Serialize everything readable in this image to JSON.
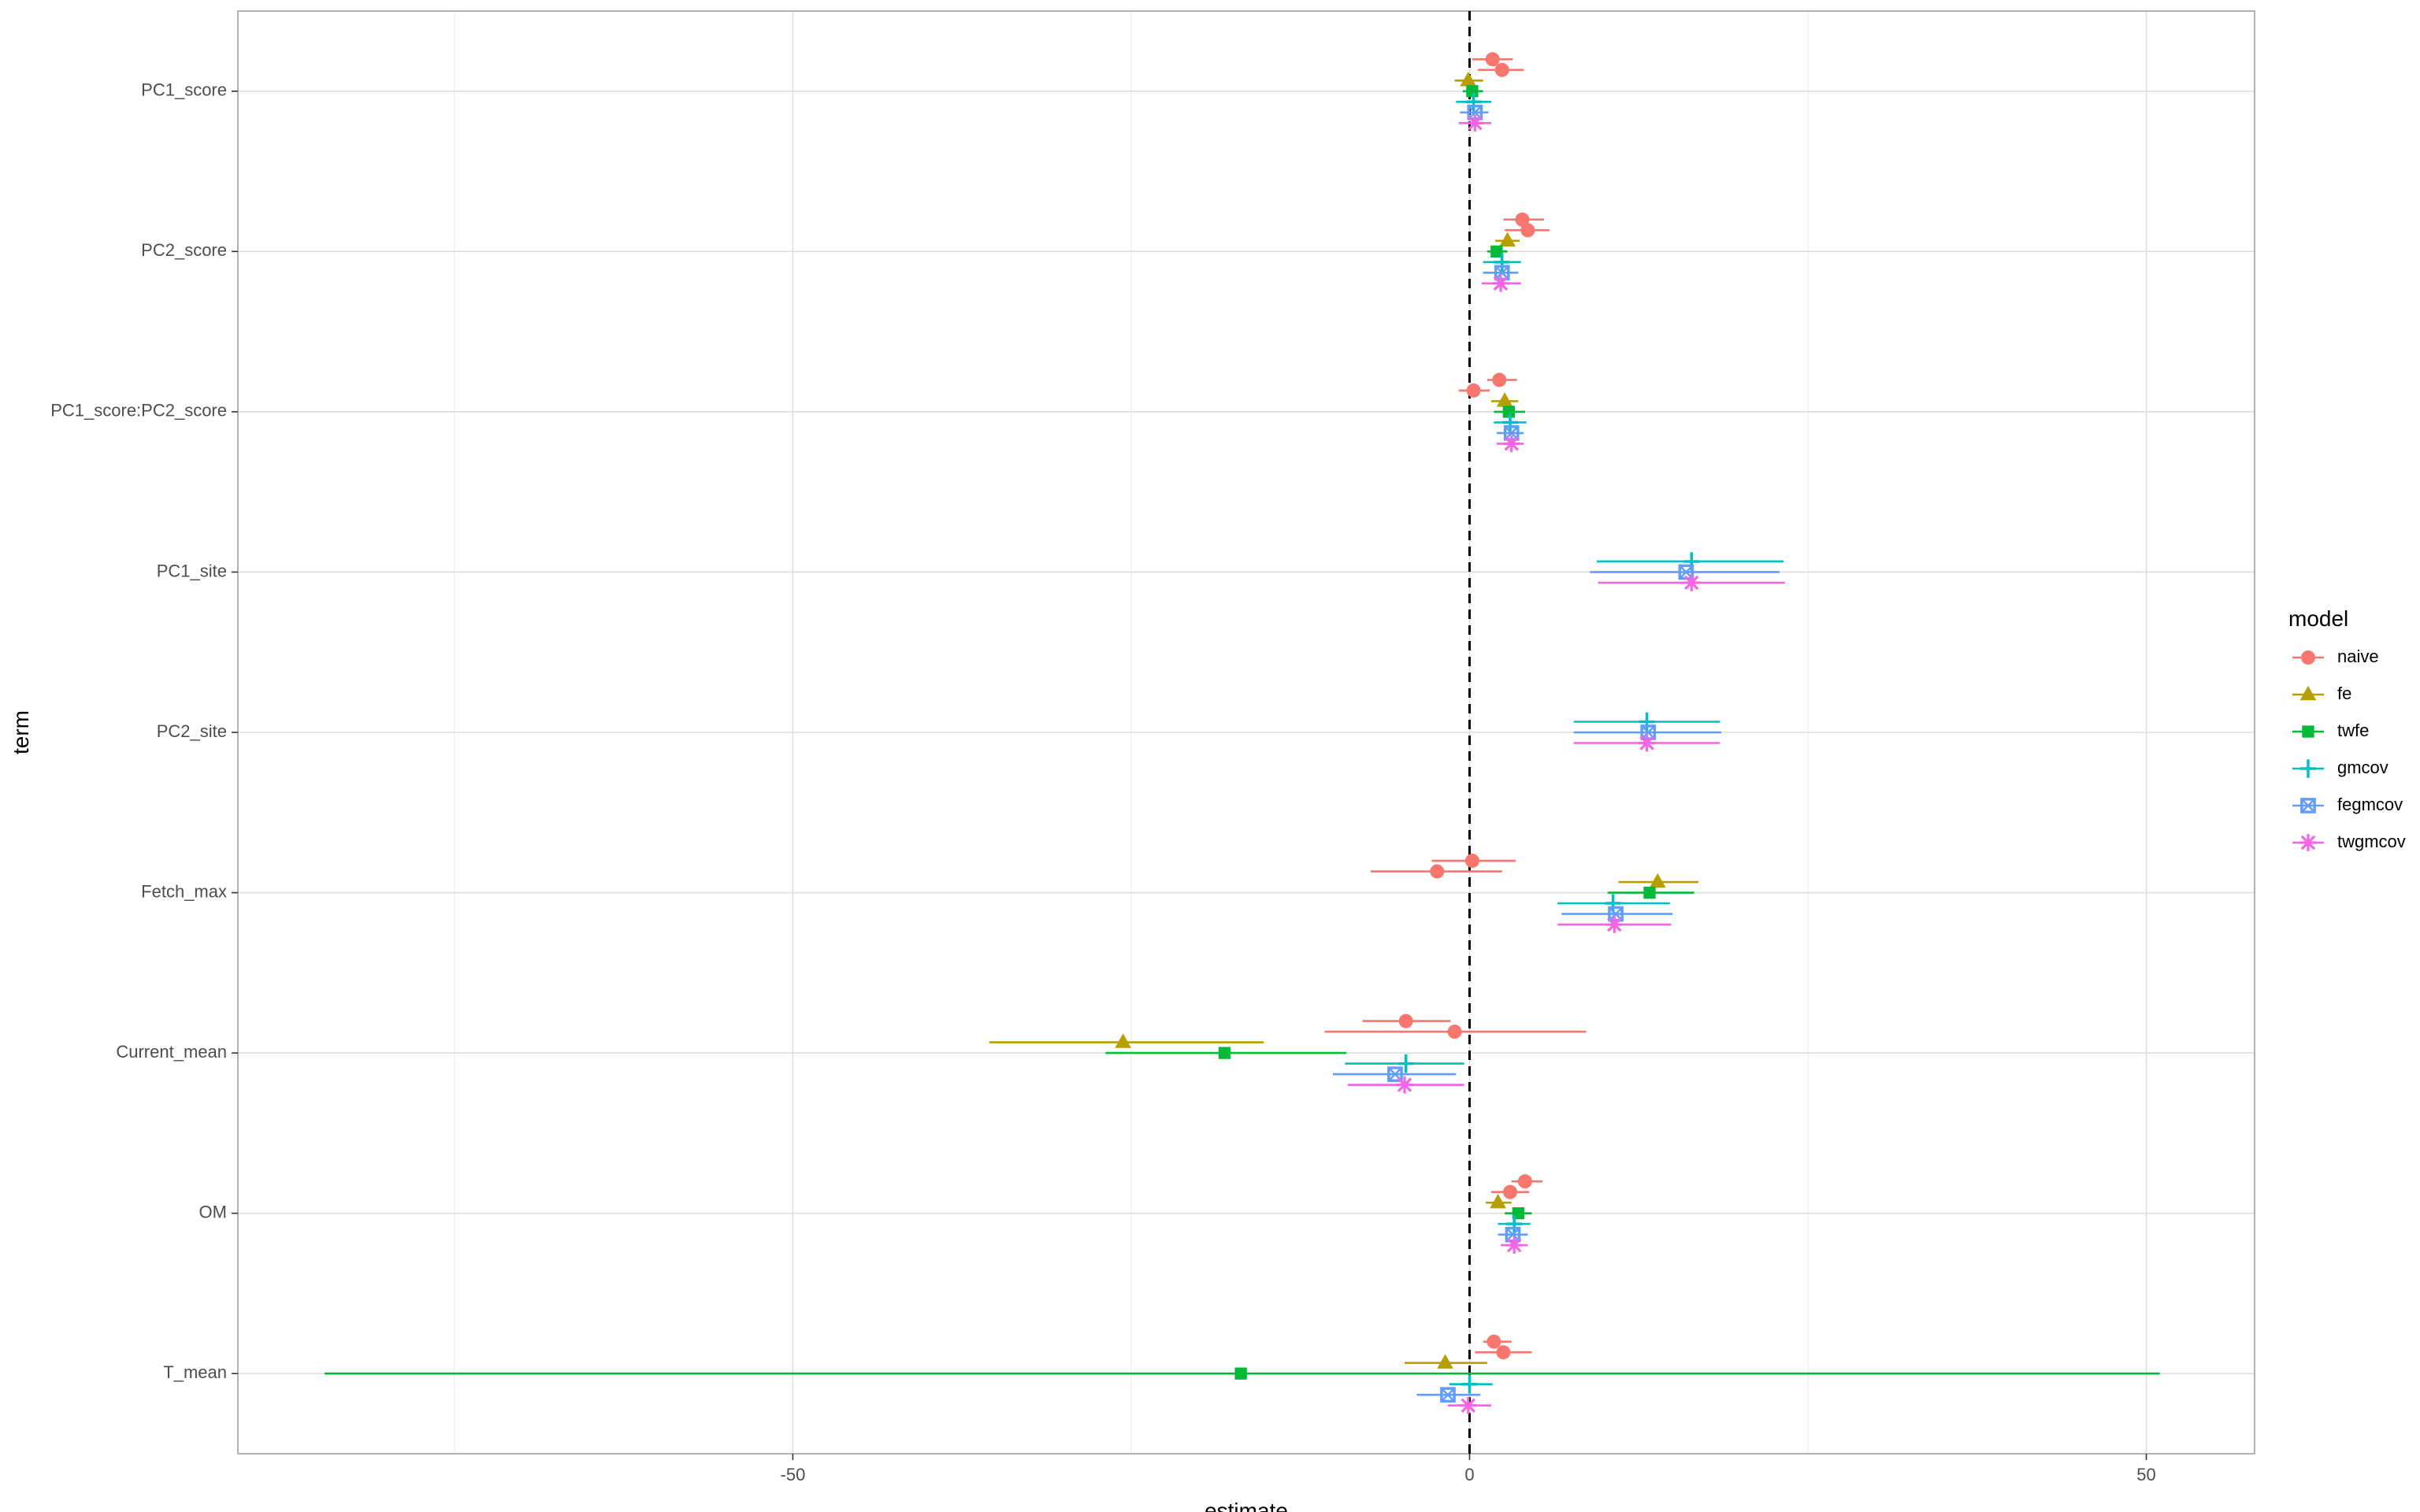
{
  "chart_data": {
    "type": "scatter",
    "subtype": "coefficient-plot",
    "title": "",
    "xlabel": "estimate",
    "ylabel": "term",
    "xlim": [
      -91,
      58
    ],
    "xticks": [
      -50,
      0,
      50
    ],
    "xtick_labels": [
      "-50",
      "0",
      "50"
    ],
    "reference_line": 0,
    "grid": true,
    "legend_title": "model",
    "legend_position": "right",
    "terms": [
      "PC1_score",
      "PC2_score",
      "PC1_score:PC2_score",
      "PC1_site",
      "PC2_site",
      "Fetch_max",
      "Current_mean",
      "OM",
      "T_mean"
    ],
    "series": [
      {
        "name": "naive",
        "color": "#F8766D",
        "shape": "circle",
        "points": [
          {
            "term": "PC1_score",
            "estimate": 1.7,
            "low": 0.2,
            "high": 3.2
          },
          {
            "term": "PC1_score",
            "estimate": 2.4,
            "low": 0.6,
            "high": 4.0
          },
          {
            "term": "PC2_score",
            "estimate": 3.9,
            "low": 2.5,
            "high": 5.5
          },
          {
            "term": "PC2_score",
            "estimate": 4.3,
            "low": 2.6,
            "high": 5.9
          },
          {
            "term": "PC1_score:PC2_score",
            "estimate": 2.2,
            "low": 1.3,
            "high": 3.5
          },
          {
            "term": "PC1_score:PC2_score",
            "estimate": 0.3,
            "low": -0.8,
            "high": 1.5
          },
          {
            "term": "Fetch_max",
            "estimate": 0.2,
            "low": -2.8,
            "high": 3.4
          },
          {
            "term": "Fetch_max",
            "estimate": -2.4,
            "low": -7.3,
            "high": 2.4
          },
          {
            "term": "Current_mean",
            "estimate": -4.7,
            "low": -7.9,
            "high": -1.4
          },
          {
            "term": "Current_mean",
            "estimate": -1.1,
            "low": -10.7,
            "high": 8.6
          },
          {
            "term": "OM",
            "estimate": 4.1,
            "low": 3.1,
            "high": 5.4
          },
          {
            "term": "OM",
            "estimate": 3.0,
            "low": 1.6,
            "high": 4.4
          },
          {
            "term": "T_mean",
            "estimate": 1.8,
            "low": 1.0,
            "high": 3.1
          },
          {
            "term": "T_mean",
            "estimate": 2.5,
            "low": 0.4,
            "high": 4.6
          }
        ]
      },
      {
        "name": "fe",
        "color": "#B79F00",
        "shape": "triangle",
        "points": [
          {
            "term": "PC1_score",
            "estimate": -0.1,
            "low": -1.1,
            "high": 1.0
          },
          {
            "term": "PC2_score",
            "estimate": 2.8,
            "low": 1.9,
            "high": 3.7
          },
          {
            "term": "PC1_score:PC2_score",
            "estimate": 2.6,
            "low": 1.6,
            "high": 3.6
          },
          {
            "term": "Fetch_max",
            "estimate": 13.9,
            "low": 11.0,
            "high": 16.9
          },
          {
            "term": "Current_mean",
            "estimate": -25.6,
            "low": -35.5,
            "high": -15.2
          },
          {
            "term": "OM",
            "estimate": 2.1,
            "low": 1.2,
            "high": 3.1
          },
          {
            "term": "T_mean",
            "estimate": -1.8,
            "low": -4.8,
            "high": 1.3
          }
        ]
      },
      {
        "name": "twfe",
        "color": "#00BA38",
        "shape": "square",
        "points": [
          {
            "term": "PC1_score",
            "estimate": 0.2,
            "low": -0.5,
            "high": 1.0
          },
          {
            "term": "PC2_score",
            "estimate": 2.0,
            "low": 1.3,
            "high": 2.8
          },
          {
            "term": "PC1_score:PC2_score",
            "estimate": 2.9,
            "low": 1.8,
            "high": 4.1
          },
          {
            "term": "Fetch_max",
            "estimate": 13.3,
            "low": 10.2,
            "high": 16.6
          },
          {
            "term": "Current_mean",
            "estimate": -18.1,
            "low": -26.9,
            "high": -9.1
          },
          {
            "term": "OM",
            "estimate": 3.6,
            "low": 2.6,
            "high": 4.6
          },
          {
            "term": "T_mean",
            "estimate": -16.9,
            "low": -84.6,
            "high": 51.0
          }
        ]
      },
      {
        "name": "gmcov",
        "color": "#00BFC4",
        "shape": "plus",
        "points": [
          {
            "term": "PC1_score",
            "estimate": 0.3,
            "low": -1.0,
            "high": 1.6
          },
          {
            "term": "PC2_score",
            "estimate": 2.4,
            "low": 1.0,
            "high": 3.8
          },
          {
            "term": "PC1_score:PC2_score",
            "estimate": 3.0,
            "low": 1.8,
            "high": 4.2
          },
          {
            "term": "PC1_site",
            "estimate": 16.4,
            "low": 9.4,
            "high": 23.2
          },
          {
            "term": "PC2_site",
            "estimate": 13.1,
            "low": 7.7,
            "high": 18.5
          },
          {
            "term": "Fetch_max",
            "estimate": 10.6,
            "low": 6.5,
            "high": 14.8
          },
          {
            "term": "Current_mean",
            "estimate": -4.7,
            "low": -9.2,
            "high": -0.4
          },
          {
            "term": "OM",
            "estimate": 3.3,
            "low": 2.1,
            "high": 4.5
          },
          {
            "term": "T_mean",
            "estimate": 0.0,
            "low": -1.5,
            "high": 1.7
          }
        ]
      },
      {
        "name": "fegmcov",
        "color": "#619CFF",
        "shape": "square-cross",
        "points": [
          {
            "term": "PC1_score",
            "estimate": 0.4,
            "low": -0.7,
            "high": 1.4
          },
          {
            "term": "PC2_score",
            "estimate": 2.4,
            "low": 1.0,
            "high": 3.6
          },
          {
            "term": "PC1_score:PC2_score",
            "estimate": 3.1,
            "low": 2.0,
            "high": 4.0
          },
          {
            "term": "PC1_site",
            "estimate": 16.0,
            "low": 8.9,
            "high": 22.9
          },
          {
            "term": "PC2_site",
            "estimate": 13.2,
            "low": 7.7,
            "high": 18.6
          },
          {
            "term": "Fetch_max",
            "estimate": 10.8,
            "low": 6.8,
            "high": 15.0
          },
          {
            "term": "Current_mean",
            "estimate": -5.5,
            "low": -10.1,
            "high": -1.0
          },
          {
            "term": "OM",
            "estimate": 3.2,
            "low": 2.1,
            "high": 4.3
          },
          {
            "term": "T_mean",
            "estimate": -1.6,
            "low": -3.9,
            "high": 0.8
          }
        ]
      },
      {
        "name": "twgmcov",
        "color": "#F564E3",
        "shape": "asterisk",
        "points": [
          {
            "term": "PC1_score",
            "estimate": 0.4,
            "low": -0.8,
            "high": 1.6
          },
          {
            "term": "PC2_score",
            "estimate": 2.3,
            "low": 0.9,
            "high": 3.8
          },
          {
            "term": "PC1_score:PC2_score",
            "estimate": 3.1,
            "low": 2.0,
            "high": 4.0
          },
          {
            "term": "PC1_site",
            "estimate": 16.4,
            "low": 9.5,
            "high": 23.3
          },
          {
            "term": "PC2_site",
            "estimate": 13.1,
            "low": 7.7,
            "high": 18.5
          },
          {
            "term": "Fetch_max",
            "estimate": 10.7,
            "low": 6.5,
            "high": 14.9
          },
          {
            "term": "Current_mean",
            "estimate": -4.8,
            "low": -9.0,
            "high": -0.4
          },
          {
            "term": "OM",
            "estimate": 3.3,
            "low": 2.3,
            "high": 4.3
          },
          {
            "term": "T_mean",
            "estimate": -0.1,
            "low": -1.6,
            "high": 1.6
          }
        ]
      }
    ]
  }
}
